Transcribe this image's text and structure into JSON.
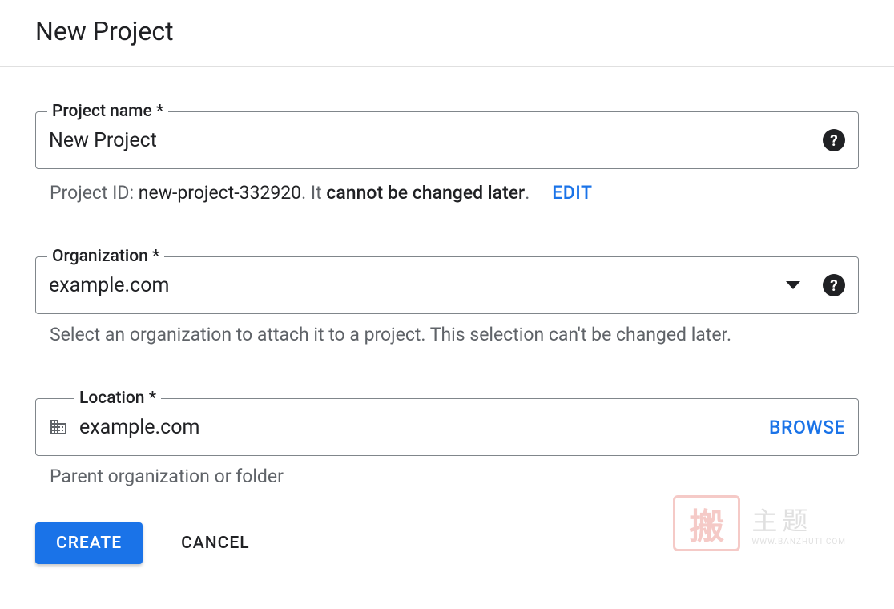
{
  "header": {
    "title": "New Project"
  },
  "projectName": {
    "label": "Project name *",
    "value": "New Project"
  },
  "projectId": {
    "prefix": "Project ID: ",
    "value": "new-project-332920",
    "suffix_plain": ". It ",
    "suffix_bold": "cannot be changed later",
    "suffix_end": ".",
    "editLabel": "EDIT"
  },
  "organization": {
    "label": "Organization *",
    "value": "example.com",
    "helper": "Select an organization to attach it to a project. This selection can't be changed later."
  },
  "location": {
    "label": "Location *",
    "value": "example.com",
    "browseLabel": "BROWSE",
    "helper": "Parent organization or folder"
  },
  "buttons": {
    "create": "CREATE",
    "cancel": "CANCEL"
  },
  "watermark": {
    "seal": "搬",
    "text": "主题",
    "url": "WWW.BANZHUTI.COM"
  }
}
